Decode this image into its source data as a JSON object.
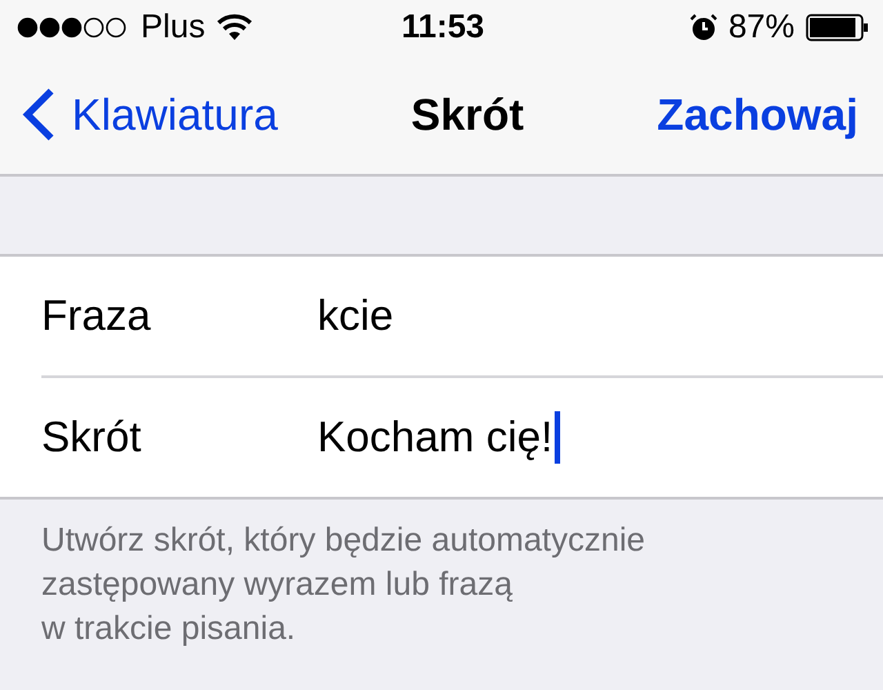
{
  "status_bar": {
    "carrier": "Plus",
    "time": "11:53",
    "battery": "87%"
  },
  "nav_bar": {
    "back": "Klawiatura",
    "title": "Skrót",
    "action": "Zachowaj"
  },
  "fields": [
    {
      "label": "Fraza",
      "value": "kcie",
      "focused": false
    },
    {
      "label": "Skrót",
      "value": "Kocham cię!",
      "focused": true
    }
  ],
  "footer": "Utwórz skrót, który będzie automatycznie\nzastępowany wyrazem lub frazą\nw trakcie pisania."
}
